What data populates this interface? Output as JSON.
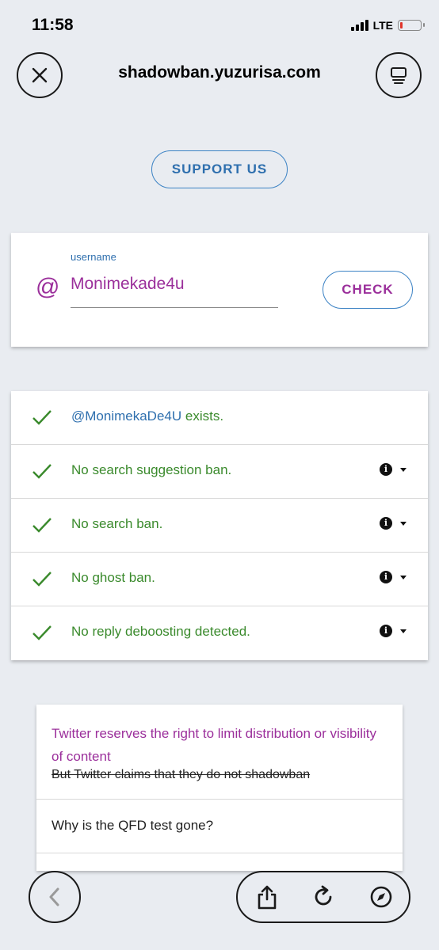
{
  "status_bar": {
    "time": "11:58",
    "network": "LTE"
  },
  "header": {
    "site_title": "shadowban.yuzurisa.com"
  },
  "support_button": {
    "label": "SUPPORT US"
  },
  "search": {
    "at_symbol": "@",
    "field_label": "username",
    "field_value": "Monimekade4u",
    "check_label": "CHECK"
  },
  "results": [
    {
      "handle": "@MonimekaDe4U",
      "text": " exists.",
      "has_info": false
    },
    {
      "text": "No search suggestion ban.",
      "has_info": true
    },
    {
      "text": "No search ban.",
      "has_info": true
    },
    {
      "text": "No ghost ban.",
      "has_info": true
    },
    {
      "text": "No reply deboosting detected.",
      "has_info": true
    }
  ],
  "faq": {
    "item1_title": "Twitter reserves the right to limit distribution or visibility of content",
    "item1_strike": "But Twitter claims that they do not shadowban",
    "item2_title": "Why is the QFD test gone?"
  },
  "icons": {
    "close": "close-icon",
    "tabs": "tabs-icon",
    "back": "chevron-left-icon",
    "share": "share-icon",
    "reload": "reload-icon",
    "compass": "compass-icon"
  },
  "colors": {
    "accent_blue": "#2e6fae",
    "accent_purple": "#9b2f9b",
    "success_green": "#3a8a2c"
  }
}
